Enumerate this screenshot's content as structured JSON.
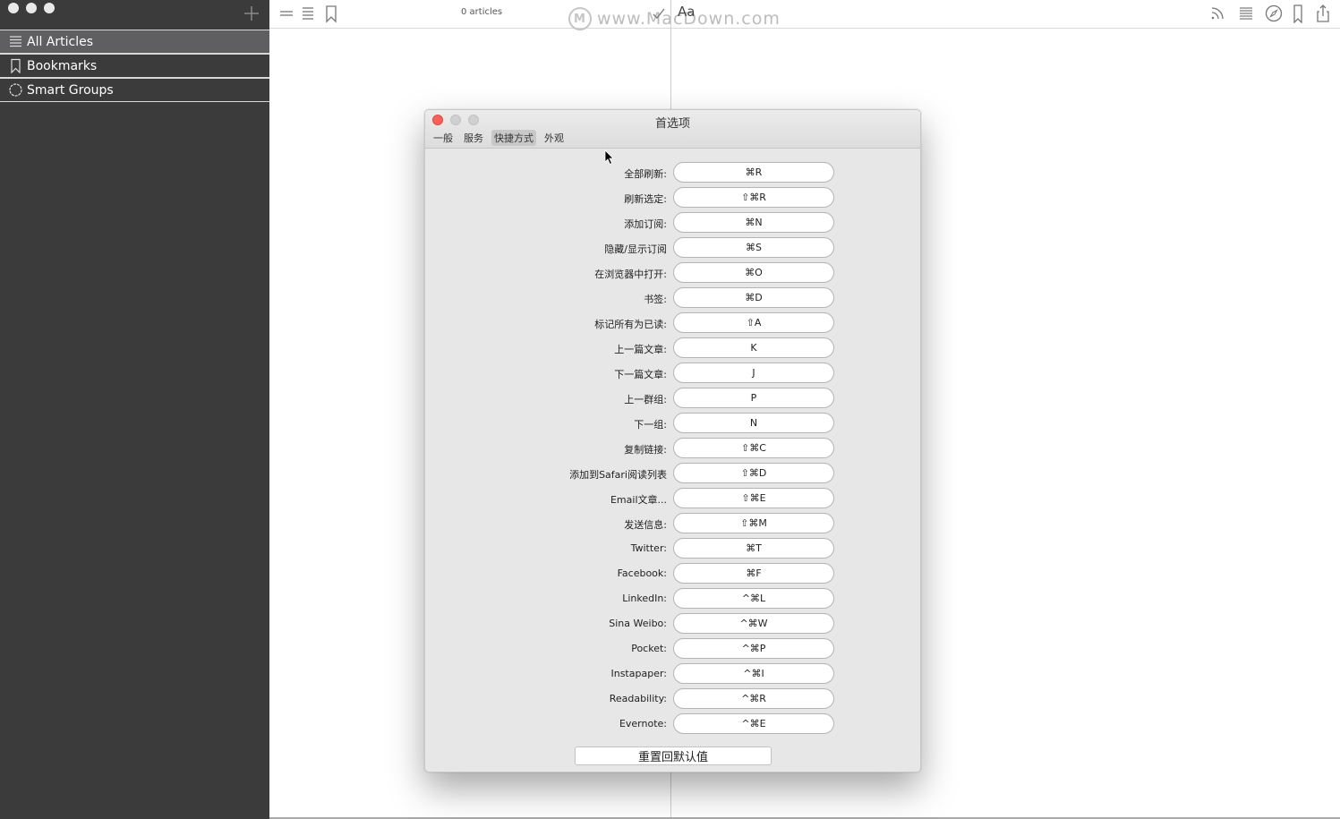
{
  "sidebar": {
    "items": [
      {
        "label": "All Articles",
        "icon": "list-icon",
        "selected": true
      },
      {
        "label": "Bookmarks",
        "icon": "bookmark-icon",
        "selected": false
      },
      {
        "label": "Smart Groups",
        "icon": "gear-icon",
        "selected": false
      }
    ]
  },
  "toolbar": {
    "article_count": "0 articles",
    "font_label": "Aa",
    "watermark_logo": "M",
    "watermark_text": "www.MacDown.com"
  },
  "dialog": {
    "title": "首选项",
    "tabs": [
      {
        "label": "一般",
        "active": false
      },
      {
        "label": "服务",
        "active": false
      },
      {
        "label": "快捷方式",
        "active": true
      },
      {
        "label": "外观",
        "active": false
      }
    ],
    "shortcuts": [
      {
        "label": "全部刷新:",
        "key": "⌘R"
      },
      {
        "label": "刷新选定:",
        "key": "⇧⌘R"
      },
      {
        "label": "添加订阅:",
        "key": "⌘N"
      },
      {
        "label": "隐藏/显示订阅",
        "key": "⌘S"
      },
      {
        "label": "在浏览器中打开:",
        "key": "⌘O"
      },
      {
        "label": "书签:",
        "key": "⌘D"
      },
      {
        "label": "标记所有为已读:",
        "key": "⇧A"
      },
      {
        "label": "上一篇文章:",
        "key": "K"
      },
      {
        "label": "下一篇文章:",
        "key": "J"
      },
      {
        "label": "上一群组:",
        "key": "P"
      },
      {
        "label": "下一组:",
        "key": "N"
      },
      {
        "label": "复制链接:",
        "key": "⇧⌘C"
      },
      {
        "label": "添加到Safari阅读列表",
        "key": "⇧⌘D"
      },
      {
        "label": "Email文章...",
        "key": "⇧⌘E"
      },
      {
        "label": "发送信息:",
        "key": "⇧⌘M"
      },
      {
        "label": "Twitter:",
        "key": "⌘T"
      },
      {
        "label": "Facebook:",
        "key": "⌘F"
      },
      {
        "label": "LinkedIn:",
        "key": "^⌘L"
      },
      {
        "label": "Sina Weibo:",
        "key": "^⌘W"
      },
      {
        "label": "Pocket:",
        "key": "^⌘P"
      },
      {
        "label": "Instapaper:",
        "key": "^⌘I"
      },
      {
        "label": "Readability:",
        "key": "^⌘R"
      },
      {
        "label": "Evernote:",
        "key": "^⌘E"
      }
    ],
    "reset_label": "重置回默认值"
  }
}
